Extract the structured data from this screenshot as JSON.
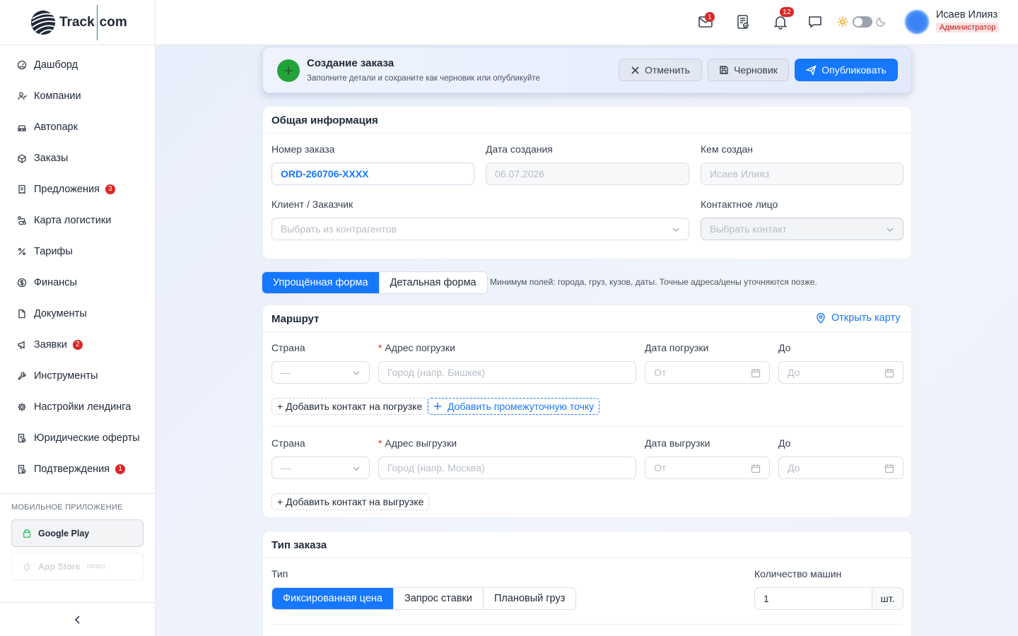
{
  "brand": {
    "left": "Track",
    "right": "com"
  },
  "sidebar": {
    "items": [
      {
        "label": "Дашборд",
        "icon": "dashboard-icon"
      },
      {
        "label": "Компании",
        "icon": "users-icon"
      },
      {
        "label": "Автопарк",
        "icon": "car-icon"
      },
      {
        "label": "Заказы",
        "icon": "box-icon"
      },
      {
        "label": "Предложения",
        "icon": "receipt-icon",
        "badge": "3"
      },
      {
        "label": "Карта логистики",
        "icon": "route-icon"
      },
      {
        "label": "Тарифы",
        "icon": "percent-icon"
      },
      {
        "label": "Финансы",
        "icon": "dollar-icon"
      },
      {
        "label": "Документы",
        "icon": "file-icon"
      },
      {
        "label": "Заявки",
        "icon": "megaphone-icon",
        "badge": "2"
      },
      {
        "label": "Инструменты",
        "icon": "wrench-icon"
      },
      {
        "label": "Настройки лендинга",
        "icon": "gear-icon"
      },
      {
        "label": "Юридические оферты",
        "icon": "document-check-icon"
      },
      {
        "label": "Подтверждения",
        "icon": "document-check-icon",
        "badge": "1"
      }
    ],
    "mobile_title": "МОБИЛЬНОЕ ПРИЛОЖЕНИЕ",
    "google_play": "Google Play",
    "app_store": "App Store",
    "app_store_soon": "· скоро"
  },
  "header": {
    "mail_badge": "1",
    "bell_badge": "12",
    "user_name": "Исаев Илияз",
    "user_role": "Администратор"
  },
  "topbar": {
    "title": "Создание заказа",
    "subtitle": "Заполните детали и сохраните как черновик или опубликуйте",
    "cancel": "Отменить",
    "draft": "Черновик",
    "publish": "Опубликовать"
  },
  "general": {
    "title": "Общая информация",
    "order_number_label": "Номер заказа",
    "order_number_value": "ORD-260706-XXXX",
    "created_date_label": "Дата создания",
    "created_date_value": "06.07.2026",
    "created_by_label": "Кем создан",
    "created_by_value": "Исаев Илияз",
    "client_label": "Клиент / Заказчик",
    "client_placeholder": "Выбрать из контрагентов",
    "contact_label": "Контактное лицо",
    "contact_placeholder": "Выбрать контакт"
  },
  "form_mode": {
    "options": [
      "Упрощённая форма",
      "Детальная форма"
    ],
    "active": 0,
    "hint": "Минимум полей: города, груз, кузов, даты. Точные адреса/цены уточняются позже."
  },
  "route": {
    "title": "Маршрут",
    "open_map": "Открыть карту",
    "loading": {
      "country_label": "Страна",
      "country_value": "—",
      "address_label": "Адрес погрузки",
      "address_placeholder": "Город (напр. Бишкек)",
      "date_label": "Дата погрузки",
      "from_placeholder": "От",
      "to_label": "До",
      "to_placeholder": "До",
      "add_contact": "+ Добавить контакт на погрузке"
    },
    "add_waypoint": "Добавить промежуточную точку",
    "unloading": {
      "country_label": "Страна",
      "country_value": "—",
      "address_label": "Адрес выгрузки",
      "address_placeholder": "Город (напр. Москва)",
      "date_label": "Дата выгрузки",
      "from_placeholder": "От",
      "to_label": "До",
      "to_placeholder": "До",
      "add_contact": "+ Добавить контакт на выгрузке"
    }
  },
  "order_type": {
    "title": "Тип заказа",
    "type_label": "Тип",
    "options": [
      "Фиксированная цена",
      "Запрос ставки",
      "Плановый груз"
    ],
    "active": 0,
    "cars_label": "Количество машин",
    "cars_value": "1",
    "cars_unit": "шт."
  }
}
